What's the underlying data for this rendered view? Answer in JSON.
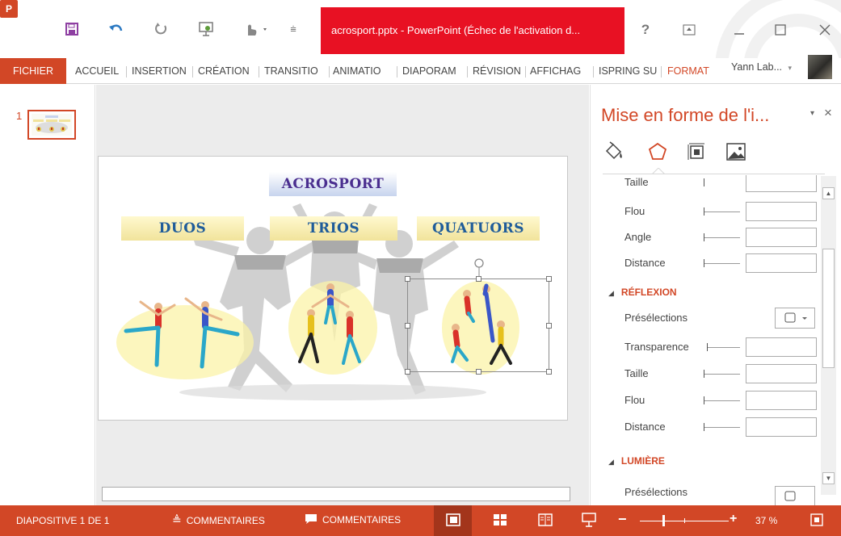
{
  "window": {
    "title": "acrosport.pptx - PowerPoint (Échec de l'activation d...",
    "app_icon": "P"
  },
  "ribbon": {
    "tabs": [
      "FICHIER",
      "ACCUEIL",
      "INSERTION",
      "CRÉATION",
      "TRANSITIO",
      "ANIMATIO",
      "DIAPORAM",
      "RÉVISION",
      "AFFICHAG",
      "ISPRING SU",
      "FORMAT"
    ],
    "user": "Yann Lab...",
    "user_caret": "▾"
  },
  "thumbnails": {
    "slide_number": "1"
  },
  "slide": {
    "title": "ACROSPORT",
    "groups": [
      "DUOS",
      "TRIOS",
      "QUATUORS"
    ]
  },
  "format_pane": {
    "title": "Mise en forme de l'i...",
    "pin": "▾",
    "close": "×",
    "shadow_rows": [
      "Taille",
      "Flou",
      "Angle",
      "Distance"
    ],
    "reflection": {
      "heading": "RÉFLEXION",
      "presets_label": "Présélections",
      "rows": [
        "Transparence",
        "Taille",
        "Flou",
        "Distance"
      ]
    },
    "glow": {
      "heading": "LUMIÈRE",
      "presets_label": "Présélections"
    }
  },
  "status": {
    "slide_info": "DIAPOSITIVE 1 DE 1",
    "notes": "COMMENTAIRES",
    "comments": "COMMENTAIRES",
    "zoom": "37 %",
    "zoom_minus": "−",
    "zoom_plus": "+"
  },
  "colors": {
    "accent": "#d24726",
    "title_bar_active": "#e81123",
    "status_dark": "#a3351b"
  }
}
